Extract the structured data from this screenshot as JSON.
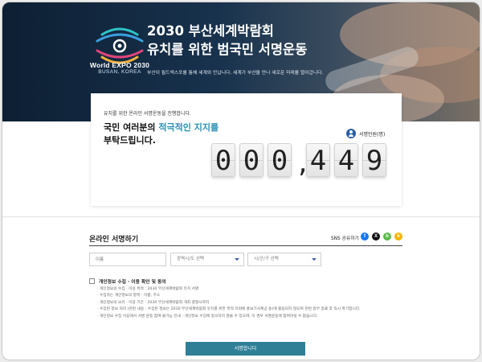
{
  "hero": {
    "logo_line1": "World EXPO 2030",
    "logo_line2": "BUSAN, KOREA",
    "title_line1": "2030 부산세계박람회",
    "title_line2": "유치를 위한 범국민 서명운동",
    "subtitle": "부산이 월드엑스포를 통해 세계와 만납니다. 세계가 부산을 만나 새로운 미래를 열어갑니다."
  },
  "counter_card": {
    "intro": "유치를 위한 온라인 서명운동을 진행합니다.",
    "headline_prefix": "국민 여러분의 ",
    "headline_highlight": "적극적인 지지를",
    "headline_line2": "부탁드립니다.",
    "count_label": "서명인원(명)",
    "digits": [
      "0",
      "0",
      "0",
      ",",
      "4",
      "4",
      "9"
    ]
  },
  "form": {
    "section_title": "온라인 서명하기",
    "sns_label": "SNS 공유하기",
    "sns_buttons": [
      {
        "name": "facebook-icon",
        "glyph": "f",
        "color": "#1877f2"
      },
      {
        "name": "x-icon",
        "glyph": "X",
        "color": "#111111"
      },
      {
        "name": "band-icon",
        "glyph": "b",
        "color": "#5bb84a"
      },
      {
        "name": "kakaostory-icon",
        "glyph": "k",
        "color": "#f5b400"
      }
    ],
    "name_placeholder": "이름",
    "region_select": "광역시/도 선택",
    "district_select": "시/군/구 선택",
    "consent_label": "개인정보 수집 · 이용 확인 및 동의",
    "consent_items": [
      "개인정보의 수집 · 이용 목적 : 2030 부산세계박람회 유치 서명",
      "수집하는 개인정보의 항목 : 이름, 주소",
      "개인정보의 보유 · 이용 기간 : 2030 부산세계박람회 개최 결정시까지",
      "수집된 정보 처리 (관련 내용 : 수집된 정보는 2030 부산세계박람회 유치를 위한 목적 이외에 홍보기사제공 등)에 활용되지 않으며 관련 업무 종료 후 즉시 파기합니다.",
      "개인정보 수집 이용에서 서명 운동 참여 불가능 안내 : 개인정보 수집에 동의하지 않을 수 있으며, 이 경우 서명운동에 참여하실 수 없습니다."
    ],
    "submit_label": "서명합니다"
  }
}
